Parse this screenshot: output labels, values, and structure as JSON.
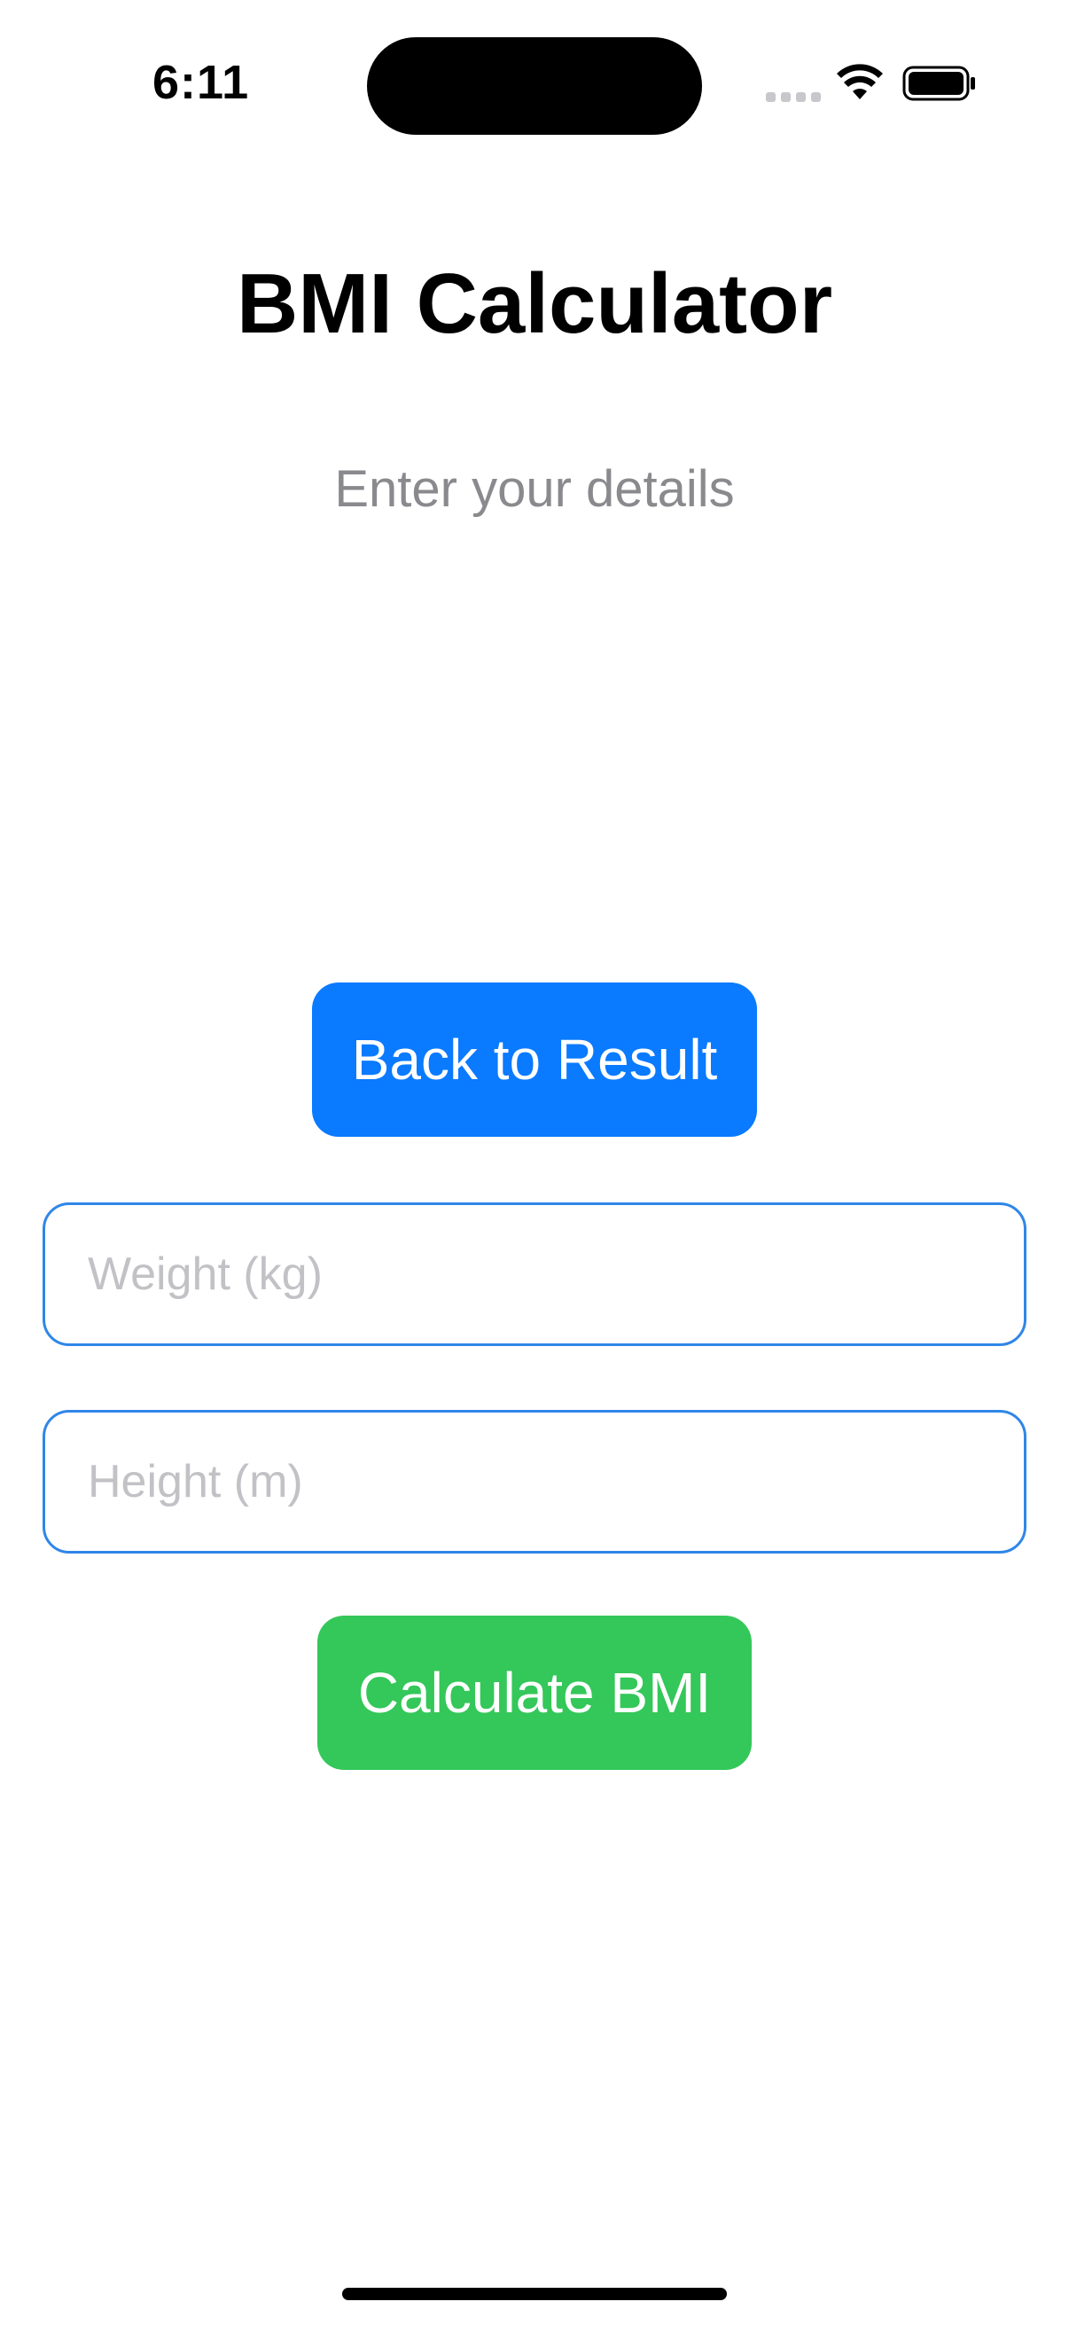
{
  "status_bar": {
    "time": "6:11",
    "icons": [
      "cellular-signal-icon",
      "wifi-icon",
      "battery-icon"
    ]
  },
  "header": {
    "title": "BMI Calculator",
    "subtitle": "Enter your details"
  },
  "actions": {
    "back_label": "Back to Result",
    "calculate_label": "Calculate BMI"
  },
  "form": {
    "weight": {
      "value": "",
      "placeholder": "Weight (kg)"
    },
    "height": {
      "value": "",
      "placeholder": "Height (m)"
    }
  },
  "colors": {
    "primary_blue": "#0a7aff",
    "success_green": "#34c759",
    "field_border": "#2f86e8",
    "subtitle_gray": "#8a8a8e"
  }
}
